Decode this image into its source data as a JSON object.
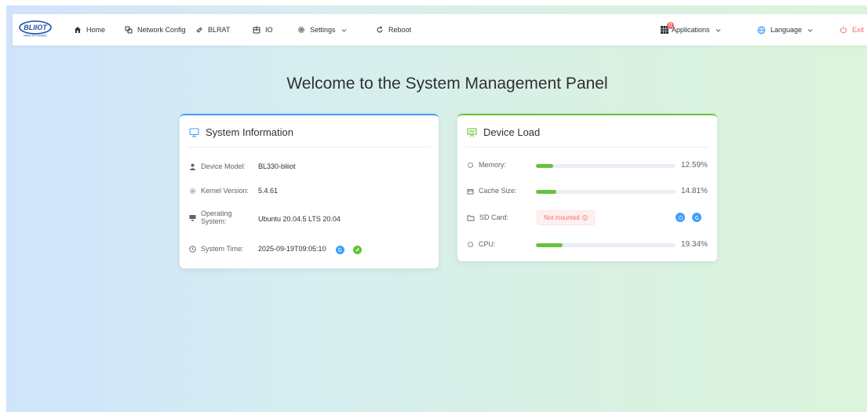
{
  "brand": {
    "logo_text": "BLIIOT",
    "tagline": "MAKE IOT EASIER"
  },
  "nav": {
    "home": "Home",
    "network_config": "Network Config",
    "blrat": "BLRAT",
    "io": "IO",
    "settings": "Settings",
    "reboot": "Reboot",
    "applications": "Applications",
    "applications_badge": "0",
    "language": "Language",
    "exit": "Exit"
  },
  "headline": "Welcome to the System Management Panel",
  "system_info": {
    "title": "System Information",
    "device_model_label": "Device Model:",
    "device_model_value": "BL330-bliiot",
    "kernel_label": "Kernel Version:",
    "kernel_value": "5.4.61",
    "os_label_line1": "Operating",
    "os_label_line2": "System:",
    "os_value": "Ubuntu 20.04.5 LTS 20.04",
    "time_label": "System Time:",
    "time_value": "2025-09-19T09:05:10"
  },
  "device_load": {
    "title": "Device Load",
    "memory_label": "Memory:",
    "memory_value": "12.59%",
    "memory_fraction": 0.1259,
    "cache_label": "Cache Size:",
    "cache_value": "14.81%",
    "cache_fraction": 0.1481,
    "sd_label": "SD Card:",
    "sd_status": "Not mounted",
    "cpu_label": "CPU:",
    "cpu_value": "19.34%",
    "cpu_fraction": 0.1934
  },
  "colors": {
    "accent_blue": "#409eff",
    "accent_green": "#67c23a",
    "danger": "#f56c6c"
  }
}
